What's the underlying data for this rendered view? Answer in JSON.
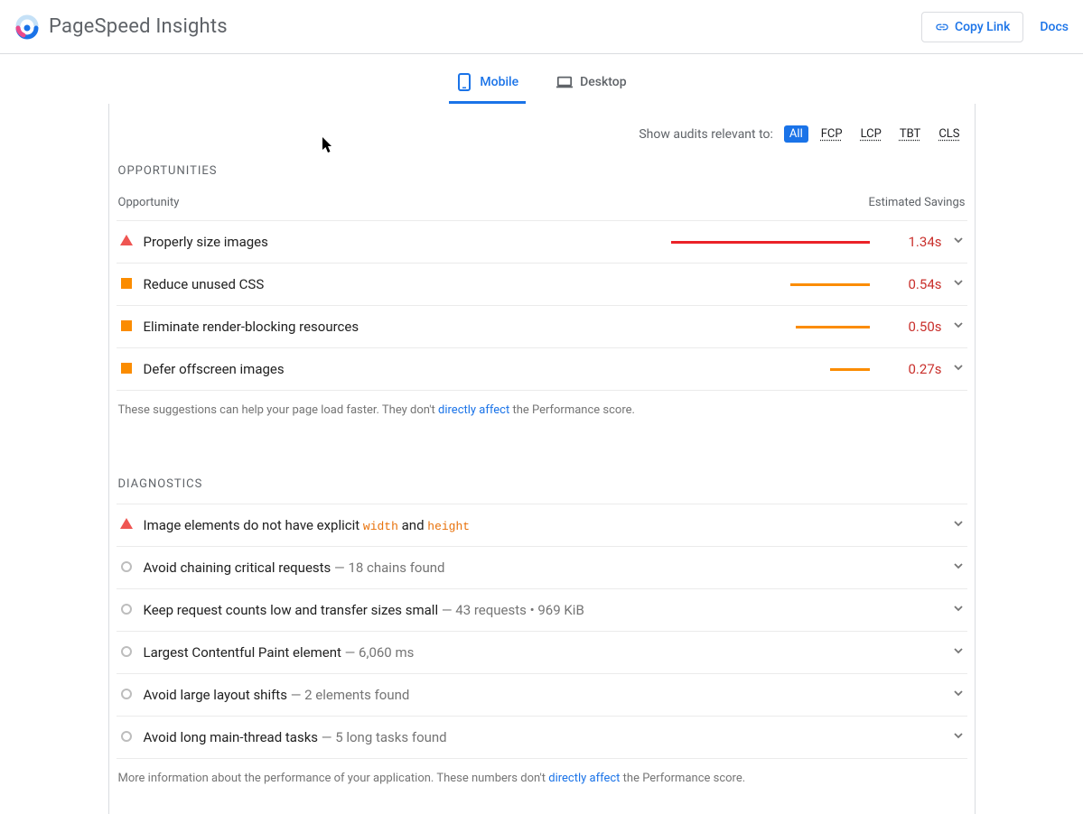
{
  "brand": "PageSpeed Insights",
  "header": {
    "copy_link": "Copy Link",
    "docs": "Docs"
  },
  "tabs": {
    "mobile": "Mobile",
    "desktop": "Desktop"
  },
  "filters": {
    "label": "Show audits relevant to:",
    "all": "All",
    "fcp": "FCP",
    "lcp": "LCP",
    "tbt": "TBT",
    "cls": "CLS"
  },
  "opportunities": {
    "title": "OPPORTUNITIES",
    "col1": "Opportunity",
    "col2": "Estimated Savings",
    "rows": [
      {
        "name": "Properly size images",
        "saving": "1.34s",
        "barWidthPct": 100,
        "barColor": "red",
        "icon": "triangle"
      },
      {
        "name": "Reduce unused CSS",
        "saving": "0.54s",
        "barWidthPct": 40,
        "barColor": "orange",
        "icon": "square"
      },
      {
        "name": "Eliminate render-blocking resources",
        "saving": "0.50s",
        "barWidthPct": 37,
        "barColor": "orange",
        "icon": "square"
      },
      {
        "name": "Defer offscreen images",
        "saving": "0.27s",
        "barWidthPct": 20,
        "barColor": "orange",
        "icon": "square"
      }
    ],
    "caption_pre": "These suggestions can help your page load faster. They don't ",
    "caption_link": "directly affect",
    "caption_post": " the Performance score."
  },
  "diagnostics": {
    "title": "DIAGNOSTICS",
    "rows": [
      {
        "icon": "triangle",
        "html": "Image elements do not have explicit <code>width</code> and <code>height</code>"
      },
      {
        "icon": "circle",
        "html": "Avoid chaining critical requests <span class='diag-sub'> — 18 chains found</span>"
      },
      {
        "icon": "circle",
        "html": "Keep request counts low and transfer sizes small <span class='diag-sub'> — 43 requests • 969 KiB</span>"
      },
      {
        "icon": "circle",
        "html": "Largest Contentful Paint element <span class='diag-sub'> — 6,060 ms</span>"
      },
      {
        "icon": "circle",
        "html": "Avoid large layout shifts <span class='diag-sub'> — 2 elements found</span>"
      },
      {
        "icon": "circle",
        "html": "Avoid long main-thread tasks <span class='diag-sub'> — 5 long tasks found</span>"
      }
    ],
    "caption_pre": "More information about the performance of your application. These numbers don't ",
    "caption_link": "directly affect",
    "caption_post": " the Performance score."
  }
}
